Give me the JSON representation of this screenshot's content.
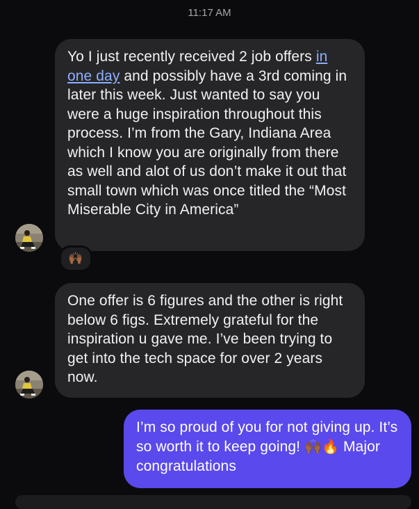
{
  "header": {
    "time": "11:17 AM"
  },
  "messages": [
    {
      "sender": "them",
      "text_before": "Yo I just recently received 2 job offers ",
      "link_text": "in one day",
      "text_after": " and possibly have a 3rd coming in later this week. Just wanted to say you were a huge inspiration throughout this process. I’m from the Gary, Indiana Area which I know you are originally from there as well and alot of us don’t make it out that small town which was once titled the “Most Miserable City in America”",
      "reaction": "🙌🏾"
    },
    {
      "sender": "them",
      "text": "One offer is 6 figures and the other is right below 6 figs. Extremely grateful for the inspiration u gave me. I’ve been trying to get into the tech space for over 2 years now."
    },
    {
      "sender": "me",
      "text": "I’m so proud of you for not giving up. It’s so worth it to keep going! ",
      "emoji": "🙌🏾🔥",
      "text_end": " Major congratulations"
    }
  ],
  "colors": {
    "background": "#0b0b0e",
    "incoming_bubble": "#262629",
    "outgoing_bubble": "#5a49ec",
    "link": "#8eb0ff"
  },
  "icons": {
    "avatar": "user-avatar-icon"
  }
}
